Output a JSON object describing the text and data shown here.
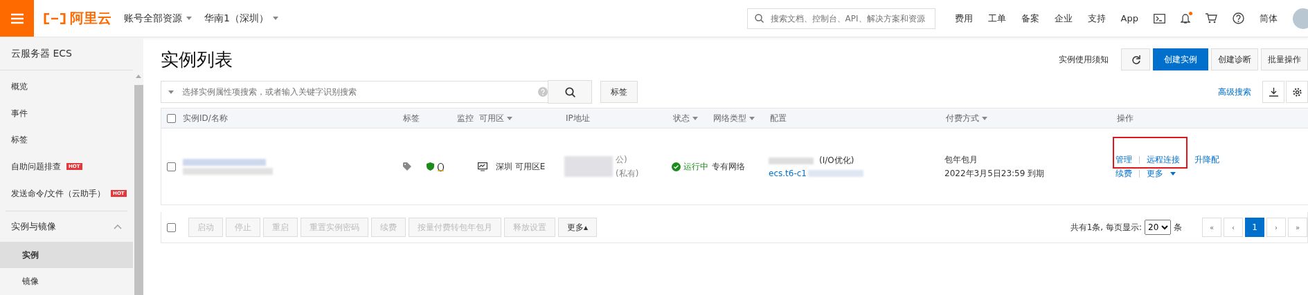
{
  "topbar": {
    "logo": "阿里云",
    "scope": "账号全部资源",
    "region": "华南1（深圳）",
    "search": {
      "placeholder": "搜索文档、控制台、API、解决方案和资源"
    },
    "links": [
      "费用",
      "工单",
      "备案",
      "企业",
      "支持",
      "App"
    ],
    "notification": {
      "unread": true
    },
    "language": "简体"
  },
  "sidebar": {
    "title": "云服务器 ECS",
    "items": [
      {
        "label": "概览",
        "hot": false
      },
      {
        "label": "事件",
        "hot": false
      },
      {
        "label": "标签",
        "hot": false
      },
      {
        "label": "自助问题排查",
        "hot": true,
        "badge": "HOT"
      },
      {
        "label": "发送命令/文件（云助手）",
        "hot": true,
        "badge": "HOT"
      }
    ],
    "group": {
      "label": "实例与镜像",
      "expanded": true,
      "children": [
        {
          "label": "实例",
          "selected": true
        },
        {
          "label": "镜像",
          "selected": false
        }
      ]
    }
  },
  "main": {
    "title": "实例列表",
    "notice": "实例使用须知",
    "buttons": [
      {
        "label": "创建实例",
        "primary": true
      },
      {
        "label": "创建诊断",
        "primary": false
      },
      {
        "label": "批量操作",
        "primary": false
      }
    ],
    "filter": {
      "placeholder": "选择实例属性项搜索，或者输入关键字识别搜索",
      "tag_button": "标签"
    },
    "advanced_search": "高级搜索",
    "columns": [
      {
        "label": "实例ID/名称",
        "filter": false
      },
      {
        "label": "标签",
        "filter": false
      },
      {
        "label": "监控",
        "filter": false
      },
      {
        "label": "可用区",
        "filter": true
      },
      {
        "label": "IP地址",
        "filter": false
      },
      {
        "label": "状态",
        "filter": true
      },
      {
        "label": "网络类型",
        "filter": true
      },
      {
        "label": "配置",
        "filter": false
      },
      {
        "label": "付费方式",
        "filter": true
      },
      {
        "label": "操作",
        "filter": false
      }
    ],
    "rows": [
      {
        "checked": false,
        "zone": "深圳 可用区E",
        "ip_public": "公)",
        "ip_private": "(私有)",
        "status": "运行中",
        "network": "专有网络",
        "config": "(I/O优化)",
        "config_link": "ecs.t6-c1",
        "billing": "包年包月",
        "expiry": "2022年3月5日23:59 到期",
        "actions": [
          "管理",
          "远程连接",
          "升降配"
        ],
        "actions_2": [
          "续费",
          "更多"
        ]
      }
    ],
    "footer": {
      "checked": false,
      "buttons": [
        {
          "label": "启动",
          "disabled": true
        },
        {
          "label": "停止",
          "disabled": true
        },
        {
          "label": "重启",
          "disabled": true
        },
        {
          "label": "重置实例密码",
          "disabled": true
        },
        {
          "label": "续费",
          "disabled": true
        },
        {
          "label": "按量付费转包年包月",
          "disabled": true
        },
        {
          "label": "释放设置",
          "disabled": true
        },
        {
          "label": "更多▴",
          "disabled": false
        }
      ],
      "total": "共有1条, 每页显示:",
      "page_size": "20",
      "unit": "条",
      "pages": [
        {
          "label": "«",
          "selected": false
        },
        {
          "label": "‹",
          "selected": false
        },
        {
          "label": "1",
          "selected": true
        },
        {
          "label": "›",
          "selected": false
        },
        {
          "label": "»",
          "selected": false
        }
      ]
    }
  }
}
